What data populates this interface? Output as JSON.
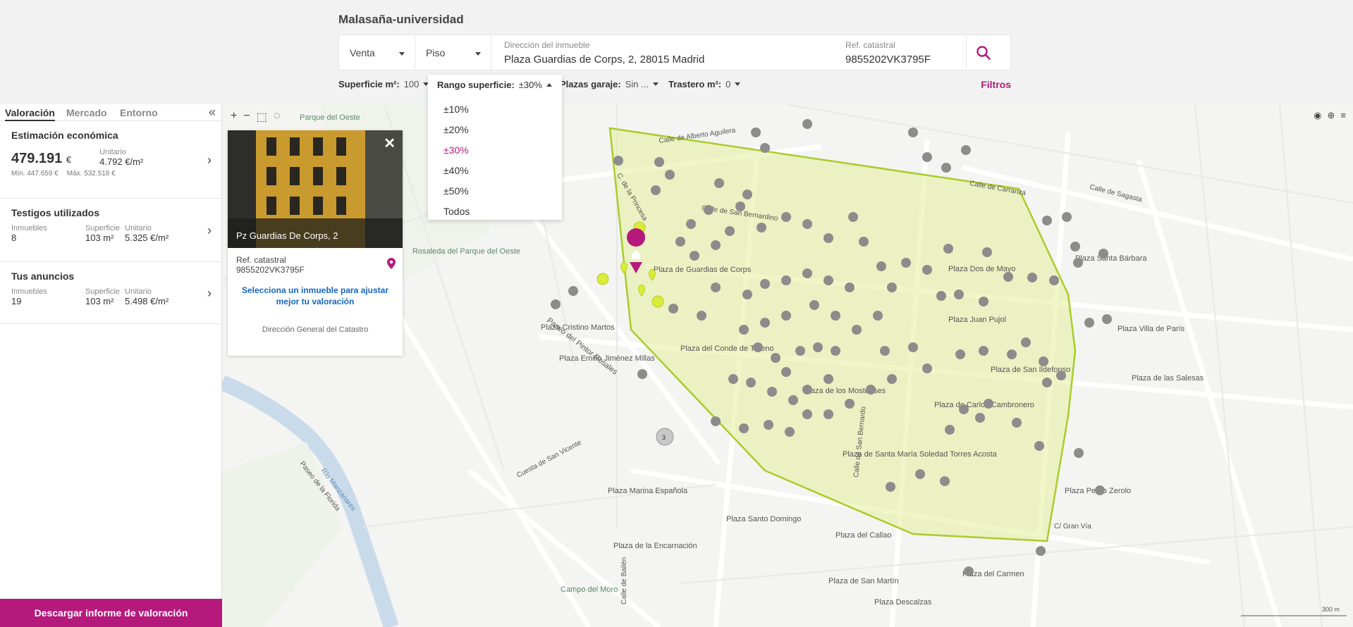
{
  "search": {
    "zone_title": "Malasaña-universidad",
    "operation": "Venta",
    "property_type": "Piso",
    "address_label": "Dirección del inmueble",
    "address_value": "Plaza Guardias de Corps, 2, 28015 Madrid",
    "ref_label": "Ref. catastral",
    "ref_value": "9855202VK3795F"
  },
  "filters": {
    "surface_label": "Superficie m²:",
    "surface_value": "100",
    "range_label": "Rango superficie:",
    "range_value": "±30%",
    "garage_label": "Plazas garaje:",
    "garage_value": "Sin ...",
    "storage_label": "Trastero m²:",
    "storage_value": "0",
    "filters_link": "Filtros",
    "range_options": [
      "±10%",
      "±20%",
      "±30%",
      "±40%",
      "±50%",
      "Todos"
    ],
    "range_selected_index": 2
  },
  "sidebar": {
    "tabs": [
      "Valoración",
      "Mercado",
      "Entorno"
    ],
    "active_tab": "Valoración",
    "estimation": {
      "title": "Estimación económica",
      "price": "479.191",
      "currency": "€",
      "unit_label": "Unitario",
      "unit_value": "4.792 €/m²",
      "min_label": "Mín.",
      "min_value": "447.659 €",
      "max_label": "Máx.",
      "max_value": "532.518 €"
    },
    "witnesses": {
      "title": "Testigos utilizados",
      "inmuebles_label": "Inmuebles",
      "inmuebles_value": "8",
      "superficie_label": "Superficie",
      "superficie_value": "103 m²",
      "unit_label": "Unitario",
      "unit_value": "5.325 €/m²"
    },
    "ads": {
      "title": "Tus anuncios",
      "inmuebles_label": "Inmuebles",
      "inmuebles_value": "19",
      "superficie_label": "Superficie",
      "superficie_value": "103 m²",
      "unit_label": "Unitario",
      "unit_value": "5.498 €/m²"
    },
    "download_button": "Descargar informe de valoración"
  },
  "card": {
    "photo_caption": "Pz Guardias De Corps, 2",
    "ref_label": "Ref. catastral",
    "ref_value": "9855202VK3795F",
    "cta": "Selecciona un inmueble para ajustar mejor tu valoración",
    "source": "Dirección General del Catastro"
  },
  "map": {
    "scale_label": "300 m",
    "cluster_count": "3",
    "labels": {
      "parque_oeste": "Parque del Oeste",
      "rosaleda": "Rosaleda del Parque del Oeste",
      "paseo_pintor_rosales": "Paseo del Pintor Rosales",
      "plaza_cristino_martos": "Plaza Cristino Martos",
      "plaza_emilio_jimenez": "Plaza Emilio Jiménez Millas",
      "plaza_guardias": "Plaza de Guardias de Corps",
      "plaza_conde_toreno": "Plaza del Conde de Toreno",
      "plaza_mostenses": "Plaza de los Mostenses",
      "plaza_dos_mayo": "Plaza Dos de Mayo",
      "plaza_juan_pujol": "Plaza Juan Pujol",
      "plaza_san_ildefonso": "Plaza de San Ildefonso",
      "plaza_carlos_cambronero": "Plaza de Carlos Cambronero",
      "plaza_santa_maria_soledad": "Plaza de Santa María Soledad Torres Acosta",
      "plaza_marina_espanola": "Plaza Marina Española",
      "plaza_santo_domingo": "Plaza Santo Domingo",
      "plaza_encarnacion": "Plaza de la Encarnación",
      "plaza_callao": "Plaza del Callao",
      "plaza_santa_barbara": "Plaza Santa Bárbara",
      "plaza_villa_paris": "Plaza Villa de París",
      "plaza_salesas": "Plaza de las Salesas",
      "plaza_pedro_zerolo": "Plaza Pedro Zerolo",
      "plaza_carmen": "Plaza del Carmen",
      "campo_moro": "Campo del Moro",
      "plaza_descalzas": "Plaza Descalzas",
      "plaza_san_martin": "Plaza de San Martín",
      "gran_via": "C/ Gran Vía",
      "calle_sagasta": "Calle de Sagasta",
      "calle_alberto_aguilera": "Calle de Alberto Aguilera",
      "calle_carranza": "Calle de Carranza",
      "calle_san_bernardo": "Calle de San Bernardo",
      "calle_san_bernardino": "Calle de San Bernardino",
      "calle_princesa": "C. de la Princesa",
      "cuesta_san_vicente": "Cuesta de San Vicente",
      "paseo_florida": "Paseo de la Florida",
      "rio_manzanares": "Río Manzanares",
      "calle_bailen": "Calle de Bailén"
    }
  }
}
